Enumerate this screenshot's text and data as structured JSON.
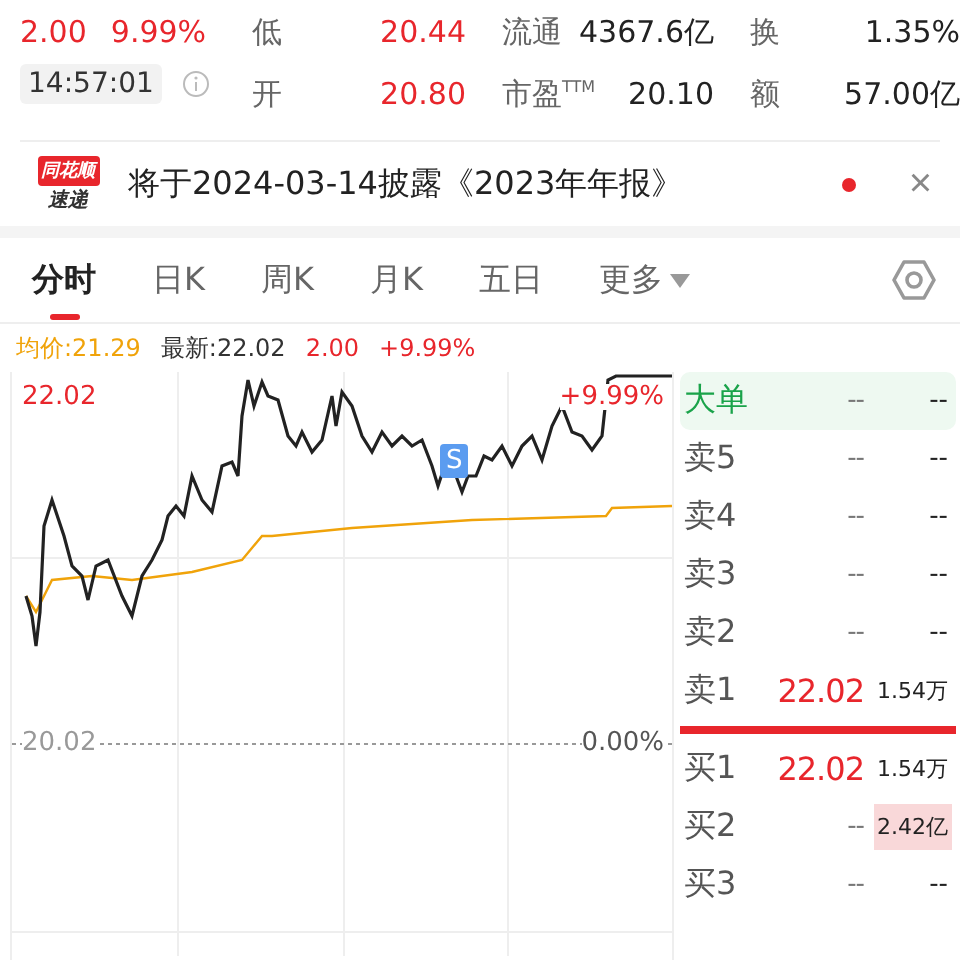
{
  "quote": {
    "change": "2.00",
    "change_pct": "9.99%",
    "time": "14:57:01"
  },
  "stats": [
    [
      {
        "label": "低",
        "value": "20.44",
        "rising": true
      },
      {
        "label": "流通",
        "value": "4367.6亿",
        "rising": false
      },
      {
        "label": "换",
        "value": "1.35%",
        "rising": false
      }
    ],
    [
      {
        "label": "开",
        "value": "20.80",
        "rising": true
      },
      {
        "label": "市盈$^{TTM}$",
        "value": "20.10",
        "rising": false
      },
      {
        "label": "额",
        "value": "57.00亿",
        "rising": false
      }
    ]
  ],
  "banner": {
    "logo_top": "同花顺",
    "logo_bottom": "速递",
    "text": "将于2024-03-14披露《2023年年报》",
    "unread": true,
    "close": "×"
  },
  "tabs": [
    {
      "label": "分时",
      "selected": true
    },
    {
      "label": "日K",
      "selected": false
    },
    {
      "label": "周K",
      "selected": false
    },
    {
      "label": "月K",
      "selected": false
    },
    {
      "label": "五日",
      "selected": false
    },
    {
      "label": "更多",
      "selected": false,
      "dropdown": true
    }
  ],
  "legend": {
    "average": "均价:21.29",
    "latest": "最新:22.02",
    "change": "2.00",
    "change_pct": "+9.99%"
  },
  "chart": {
    "top_price": "22.02",
    "top_pct": "+9.99%",
    "base_price": "20.02",
    "base_pct": "0.00%",
    "marker": "S"
  },
  "order_book": [
    {
      "kind": "big",
      "label": "大单",
      "price": "--",
      "volume": "--",
      "highlighted": false
    },
    {
      "kind": "ask",
      "label": "卖5",
      "price": "--",
      "volume": "--",
      "highlighted": false
    },
    {
      "kind": "ask",
      "label": "卖4",
      "price": "--",
      "volume": "--",
      "highlighted": false
    },
    {
      "kind": "ask",
      "label": "卖3",
      "price": "--",
      "volume": "--",
      "highlighted": false
    },
    {
      "kind": "ask",
      "label": "卖2",
      "price": "--",
      "volume": "--",
      "highlighted": false
    },
    {
      "kind": "ask",
      "label": "卖1",
      "price": "22.02",
      "volume": "1.54万",
      "highlighted": false
    },
    {
      "kind": "bid",
      "label": "买1",
      "price": "22.02",
      "volume": "1.54万",
      "highlighted": false
    },
    {
      "kind": "bid",
      "label": "买2",
      "price": "--",
      "volume": "2.42亿",
      "highlighted": true
    },
    {
      "kind": "bid",
      "label": "买3",
      "price": "--",
      "volume": "--",
      "highlighted": false
    }
  ]
}
